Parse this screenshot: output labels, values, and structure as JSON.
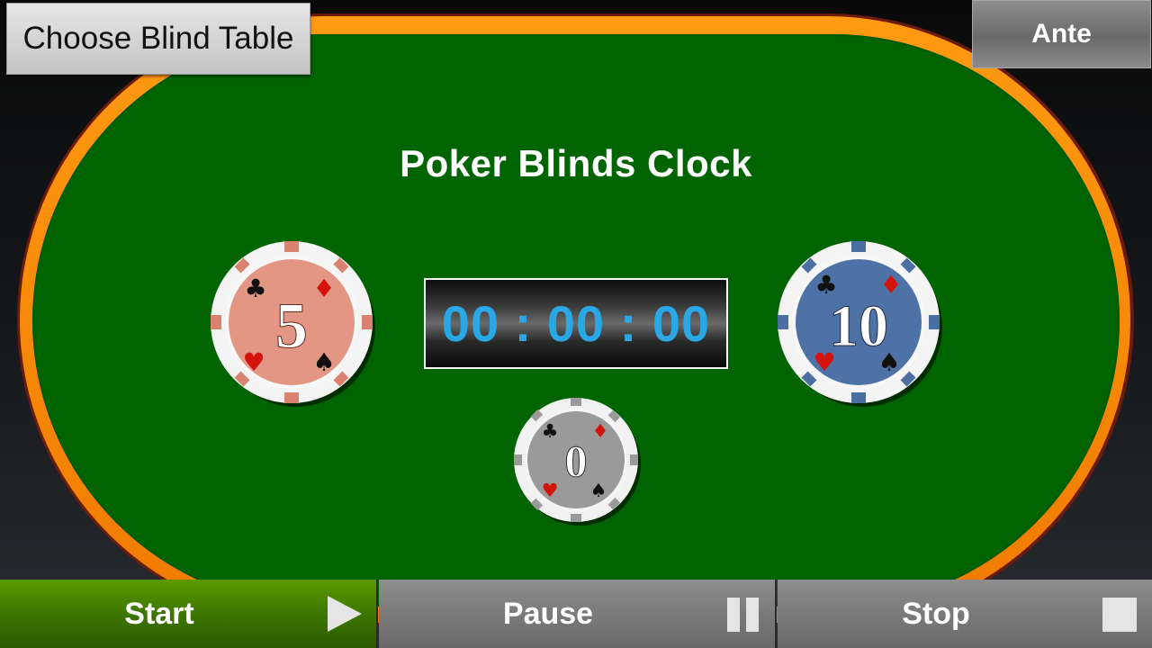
{
  "header": {
    "choose_blind_table_label": "Choose Blind Table",
    "ante_label": "Ante"
  },
  "main": {
    "title": "Poker Blinds Clock",
    "timer": "00 : 00 : 00",
    "small_blind": {
      "value": "5",
      "color": "#e39684"
    },
    "big_blind": {
      "value": "10",
      "color": "#4f72a6"
    },
    "ante": {
      "value": "0",
      "color": "#9a9a9a"
    }
  },
  "controls": {
    "start_label": "Start",
    "pause_label": "Pause",
    "stop_label": "Stop",
    "start_icon": "play-icon",
    "pause_icon": "pause-icon",
    "stop_icon": "stop-icon"
  },
  "colors": {
    "felt": "#006400",
    "rail": "#ff8c00",
    "timer_text": "#2aa8e6",
    "start_button": "#4c8800"
  }
}
